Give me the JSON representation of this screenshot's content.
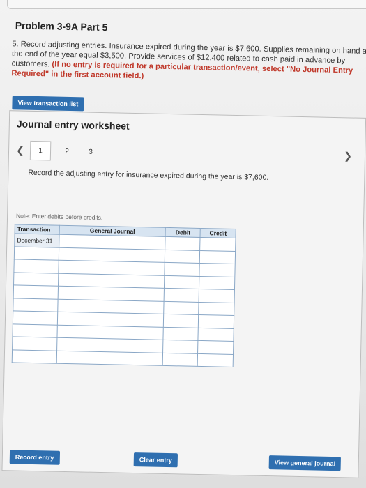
{
  "problem": {
    "title": "Problem 3-9A Part 5",
    "description": "5. Record adjusting entries. Insurance expired during the year is $7,600. Supplies remaining on hand at the end of the year equal $3,500. Provide services of $12,400 related to cash paid in advance by customers.",
    "hint": "(If no entry is required for a particular transaction/event, select \"No Journal Entry Required\" in the first account field.)"
  },
  "buttons": {
    "view_transaction_list": "View transaction list",
    "record_entry": "Record entry",
    "clear_entry": "Clear entry",
    "view_general_journal": "View general journal"
  },
  "worksheet": {
    "title": "Journal entry worksheet",
    "pages": [
      "1",
      "2",
      "3"
    ],
    "instruction": "Record the adjusting entry for insurance expired during the year is $7,600.",
    "note": "Note: Enter debits before credits."
  },
  "journal": {
    "headers": {
      "transaction": "Transaction",
      "general_journal": "General Journal",
      "debit": "Debit",
      "credit": "Credit"
    },
    "first_transaction": "December 31",
    "row_count": 10
  }
}
